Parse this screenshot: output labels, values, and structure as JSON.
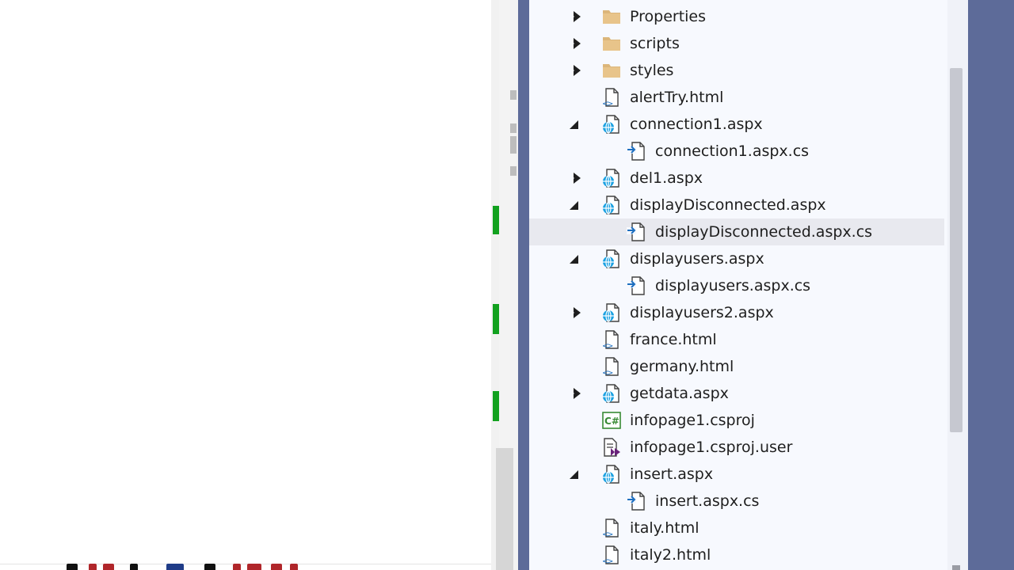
{
  "solution_explorer": {
    "items": [
      {
        "label": "Properties",
        "icon": "folder-icon",
        "expander": "collapsed",
        "level": 1
      },
      {
        "label": "scripts",
        "icon": "folder-icon",
        "expander": "collapsed",
        "level": 1
      },
      {
        "label": "styles",
        "icon": "folder-icon",
        "expander": "collapsed",
        "level": 1
      },
      {
        "label": "alertTry.html",
        "icon": "html-file-icon",
        "expander": "none",
        "level": 1
      },
      {
        "label": "connection1.aspx",
        "icon": "web-form-icon",
        "expander": "expanded",
        "level": 1
      },
      {
        "label": "connection1.aspx.cs",
        "icon": "code-behind-file-icon",
        "expander": "none",
        "level": 2
      },
      {
        "label": "del1.aspx",
        "icon": "web-form-icon",
        "expander": "collapsed",
        "level": 1
      },
      {
        "label": "displayDisconnected.aspx",
        "icon": "web-form-icon",
        "expander": "expanded",
        "level": 1
      },
      {
        "label": "displayDisconnected.aspx.cs",
        "icon": "code-behind-file-icon",
        "expander": "none",
        "level": 2,
        "selected": true
      },
      {
        "label": "displayusers.aspx",
        "icon": "web-form-icon",
        "expander": "expanded",
        "level": 1
      },
      {
        "label": "displayusers.aspx.cs",
        "icon": "code-behind-file-icon",
        "expander": "none",
        "level": 2
      },
      {
        "label": "displayusers2.aspx",
        "icon": "web-form-icon",
        "expander": "collapsed",
        "level": 1
      },
      {
        "label": "france.html",
        "icon": "html-file-icon",
        "expander": "none",
        "level": 1
      },
      {
        "label": "germany.html",
        "icon": "html-file-icon",
        "expander": "none",
        "level": 1
      },
      {
        "label": "getdata.aspx",
        "icon": "web-form-icon",
        "expander": "collapsed",
        "level": 1
      },
      {
        "label": "infopage1.csproj",
        "icon": "csharp-project-icon",
        "expander": "none",
        "level": 1
      },
      {
        "label": "infopage1.csproj.user",
        "icon": "project-user-file-icon",
        "expander": "none",
        "level": 1
      },
      {
        "label": "insert.aspx",
        "icon": "web-form-icon",
        "expander": "expanded",
        "level": 1
      },
      {
        "label": "insert.aspx.cs",
        "icon": "code-behind-file-icon",
        "expander": "none",
        "level": 2
      },
      {
        "label": "italy.html",
        "icon": "html-file-icon",
        "expander": "none",
        "level": 1
      },
      {
        "label": "italy2.html",
        "icon": "html-file-icon",
        "expander": "none",
        "level": 1
      }
    ]
  },
  "colors": {
    "frame": "#5d6b99",
    "explorer_bg": "#f7f9fe",
    "selected_row": "#e8e9ef",
    "folder": "#dcb67a",
    "globe": "#1ba1e2",
    "code_arrow": "#1e6fbf",
    "csharp": "#388a34",
    "change_marker": "#12a11f"
  }
}
